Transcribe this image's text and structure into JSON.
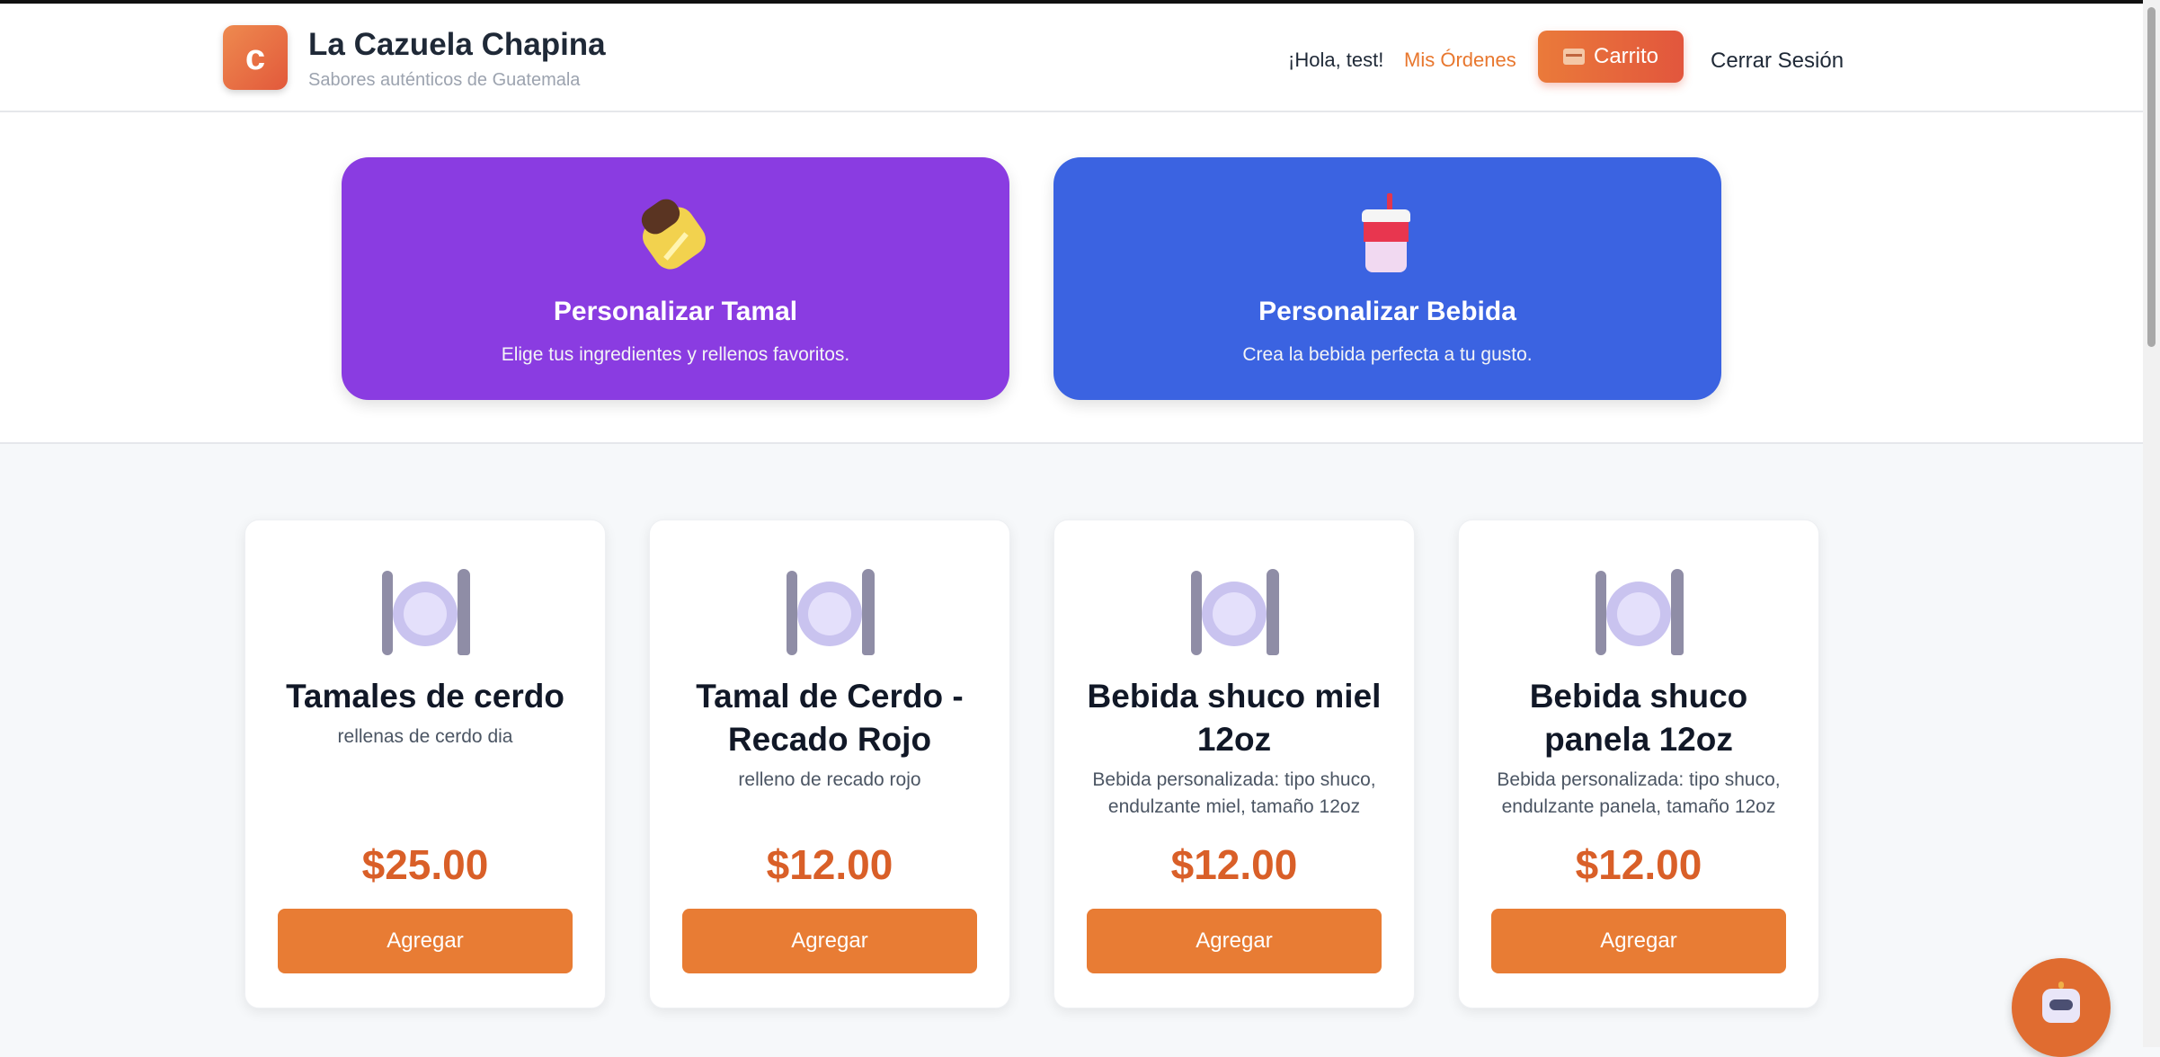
{
  "header": {
    "logo_letter": "c",
    "brand_title": "La Cazuela Chapina",
    "brand_subtitle": "Sabores auténticos de Guatemala",
    "greeting": "¡Hola, test!",
    "orders_link": "Mis Órdenes",
    "cart_label": "Carrito",
    "cart_icon": "cart-icon",
    "logout_label": "Cerrar Sesión"
  },
  "customize": [
    {
      "title": "Personalizar Tamal",
      "description": "Elige tus ingredientes y rellenos favoritos.",
      "icon": "tamal-icon",
      "color": "#8a3ce1"
    },
    {
      "title": "Personalizar Bebida",
      "description": "Crea la bebida perfecta a tu gusto.",
      "icon": "drink-cup-icon",
      "color": "#3b63e1"
    }
  ],
  "products": [
    {
      "name": "Tamales de cerdo",
      "description": "rellenas de cerdo dia",
      "price": "$25.00",
      "button": "Agregar",
      "icon": "plate-cutlery-icon"
    },
    {
      "name": "Tamal de Cerdo - Recado Rojo",
      "description": "relleno de recado rojo",
      "price": "$12.00",
      "button": "Agregar",
      "icon": "plate-cutlery-icon"
    },
    {
      "name": "Bebida shuco miel 12oz",
      "description": "Bebida personalizada: tipo shuco, endulzante miel, tamaño 12oz",
      "price": "$12.00",
      "button": "Agregar",
      "icon": "plate-cutlery-icon"
    },
    {
      "name": "Bebida shuco panela 12oz",
      "description": "Bebida personalizada: tipo shuco, endulzante panela, tamaño 12oz",
      "price": "$12.00",
      "button": "Agregar",
      "icon": "plate-cutlery-icon"
    }
  ],
  "chat_button": {
    "icon": "robot-icon"
  },
  "colors": {
    "accent": "#e87c34",
    "price": "#d95f28",
    "tamal_card": "#8a3ce1",
    "bebida_card": "#3b63e1"
  }
}
